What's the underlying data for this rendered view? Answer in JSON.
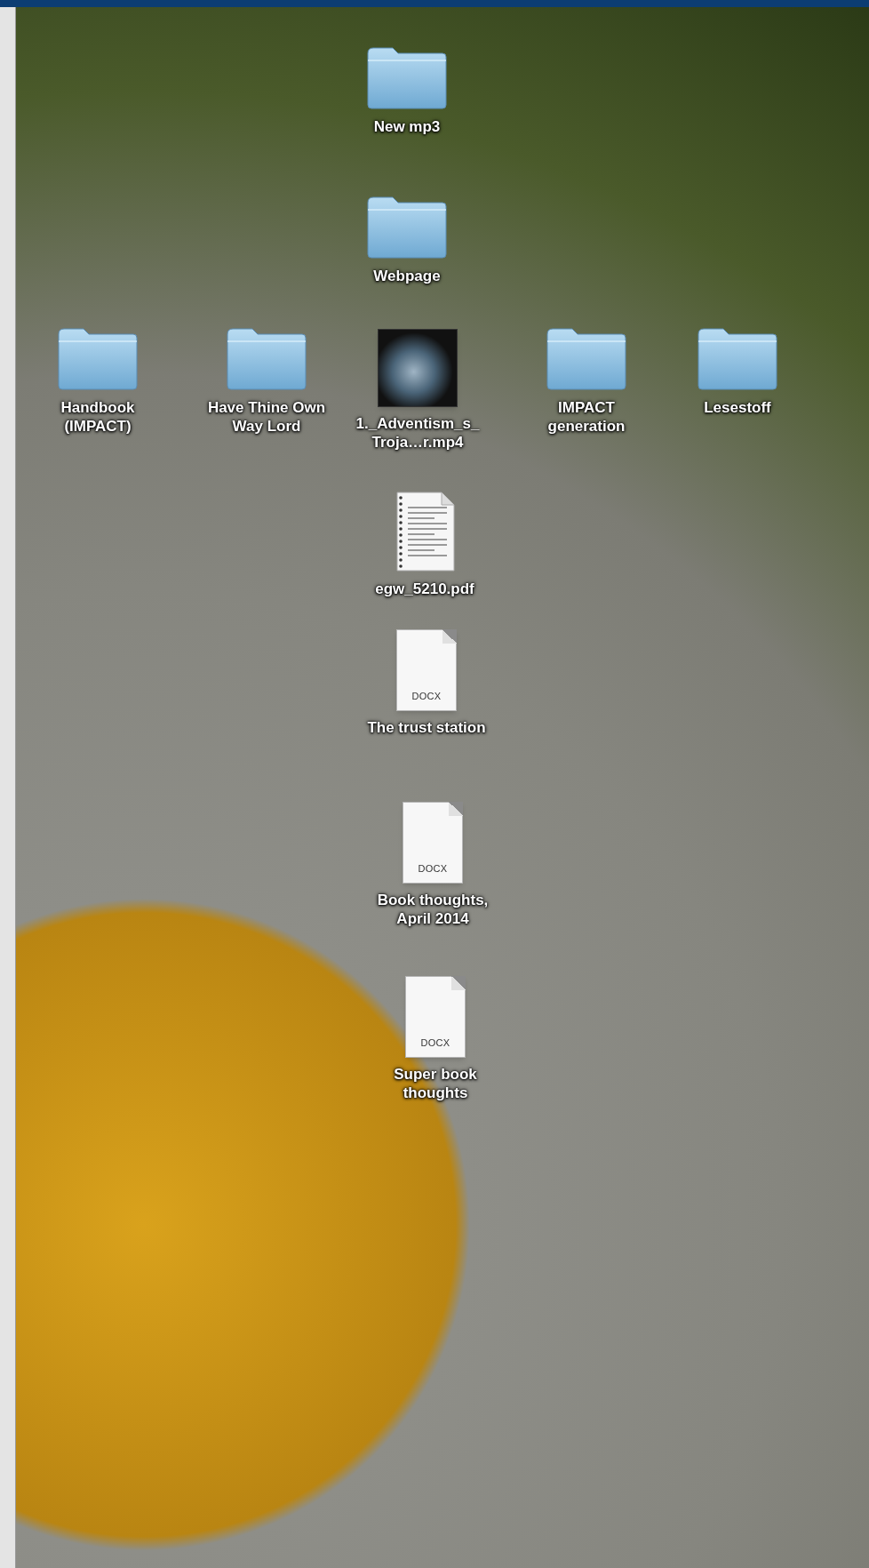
{
  "desktop_icons": [
    {
      "kind": "folder",
      "label": "New mp3"
    },
    {
      "kind": "folder",
      "label": "Webpage"
    },
    {
      "kind": "folder",
      "label": "Handbook (IMPACT)"
    },
    {
      "kind": "folder",
      "label": "Have Thine Own Way Lord"
    },
    {
      "kind": "movie",
      "label": "1._Adventism_s_Troja…r.mp4"
    },
    {
      "kind": "folder",
      "label": "IMPACT generation"
    },
    {
      "kind": "folder",
      "label": "Lesestoff"
    },
    {
      "kind": "pdf",
      "label": "egw_5210.pdf"
    },
    {
      "kind": "document",
      "badge": "DOCX",
      "label": "The trust station"
    },
    {
      "kind": "document",
      "badge": "DOCX",
      "label": "Book thoughts, April 2014"
    },
    {
      "kind": "document",
      "badge": "DOCX",
      "label": "Super book thoughts"
    }
  ]
}
